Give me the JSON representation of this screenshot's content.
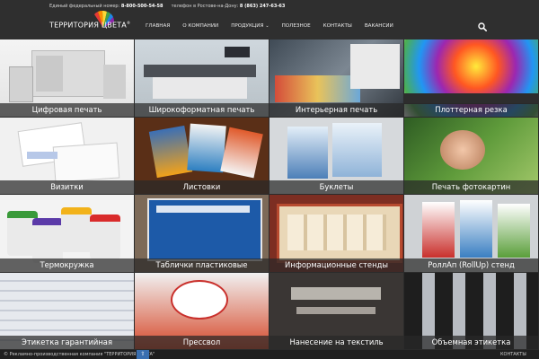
{
  "header": {
    "phone_federal_label": "Единый федеральный номер:",
    "phone_federal_number": "8-800-500-54-58",
    "phone_rostov_label": "телефон в Ростове-на-Дону:",
    "phone_rostov_number": "8 (863) 247-63-63",
    "logo_text": "ТЕРРИТОРИЯ ЦВЕТА",
    "logo_mark": "®"
  },
  "nav": {
    "items": [
      {
        "label": "Главная"
      },
      {
        "label": "О компании"
      },
      {
        "label": "Продукция"
      },
      {
        "label": "Полезное"
      },
      {
        "label": "Контакты"
      },
      {
        "label": "Вакансии"
      }
    ]
  },
  "tiles": [
    {
      "label": "Цифровая печать"
    },
    {
      "label": "Широкоформатная печать"
    },
    {
      "label": "Интерьерная печать"
    },
    {
      "label": "Плоттерная резка"
    },
    {
      "label": "Визитки"
    },
    {
      "label": "Листовки"
    },
    {
      "label": "Буклеты"
    },
    {
      "label": "Печать фотокартин"
    },
    {
      "label": "Термокружка"
    },
    {
      "label": "Таблички пластиковые"
    },
    {
      "label": "Информационные стенды"
    },
    {
      "label": "РоллАп (RollUp) стенд"
    },
    {
      "label": "Этикетка гарантийная"
    },
    {
      "label": "Прессвол"
    },
    {
      "label": "Нанесение на текстиль"
    },
    {
      "label": "Объемная этикетка"
    }
  ],
  "footer": {
    "copyright": "© Рекламно-производственная компания \"ТЕРРИТОРИЯ ЦВЕТА\"",
    "up_glyph": "⇧",
    "contacts": "КОНТАКТЫ"
  },
  "icons": {
    "search": "search-icon",
    "caret": "chevron-down-icon"
  },
  "colors": {
    "header_bg": "#2f2f2f",
    "caption_bg": "#282828",
    "footer_bg": "#1f1f1f"
  }
}
